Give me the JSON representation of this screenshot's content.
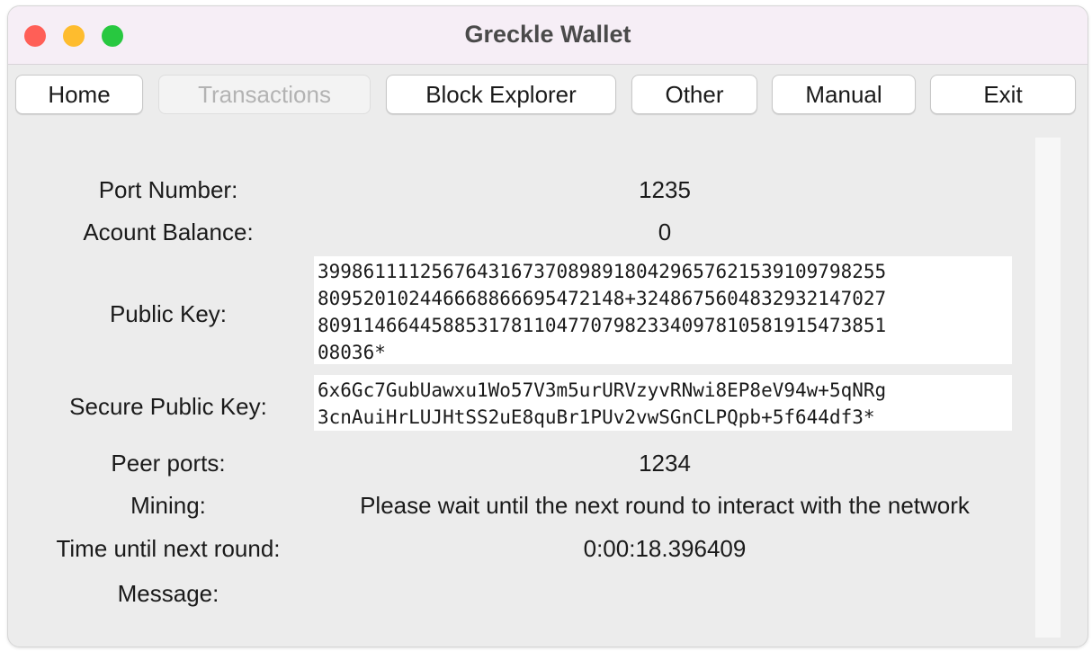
{
  "window": {
    "title": "Greckle Wallet",
    "controls": {
      "close_color": "#ff5f57",
      "minimize_color": "#febc2e",
      "zoom_color": "#28c840"
    }
  },
  "toolbar": {
    "home_label": "Home",
    "transactions_label": "Transactions",
    "block_explorer_label": "Block Explorer",
    "other_label": "Other",
    "manual_label": "Manual",
    "exit_label": "Exit"
  },
  "info": {
    "port_number_label": "Port Number:",
    "port_number_value": "1235",
    "account_balance_label": "Acount Balance:",
    "account_balance_value": "0",
    "public_key_label": "Public Key:",
    "public_key_value": "39986111125676431673708989180429657621539109798255\n80952010244666886669547214 8+3248675604832932147027\n80911466445885317811047707982334097810581915473851\n08036*",
    "secure_public_key_label": "Secure Public Key:",
    "secure_public_key_value": "6x6Gc7GubUawxu1Wo57V3m5urURVzyvRNwi8EP8eV94w+5qNRg\n3cnAuiHrLUJHtSS2uE8quBr1PUv2vwSGnCLPQpb+5f644df3*",
    "peer_ports_label": "Peer ports:",
    "peer_ports_value": "1234",
    "mining_label": "Mining:",
    "mining_value": "Please wait until the next round to interact with the network",
    "time_label": "Time until next round:",
    "time_value": "0:00:18.396409",
    "message_label": "Message:",
    "message_value": ""
  }
}
